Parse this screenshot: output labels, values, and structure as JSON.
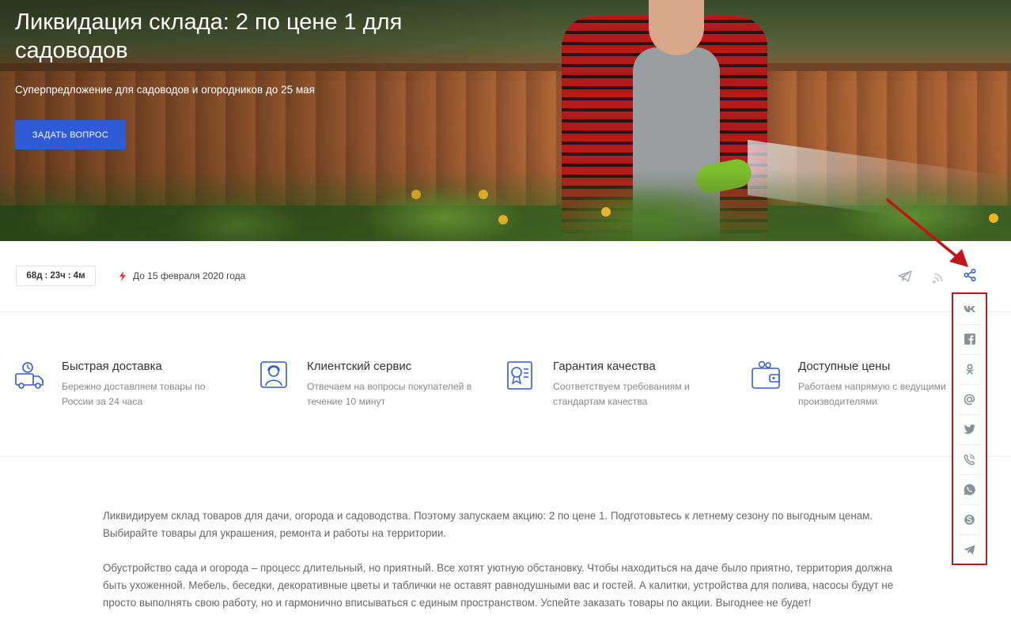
{
  "hero": {
    "title": "Ликвидация склада: 2 по цене 1 для садоводов",
    "subtitle": "Суперпредложение для садоводов и огородников до 25 мая",
    "button_label": "ЗАДАТЬ ВОПРОС"
  },
  "timer": {
    "days": "68",
    "days_unit": "д",
    "hours": "23",
    "hours_unit": "ч",
    "minutes": "4",
    "minutes_unit": "м"
  },
  "deadline": {
    "text": "До 15 февраля 2020 года",
    "icon": "lightning-icon"
  },
  "actions": [
    {
      "name": "telegram-icon"
    },
    {
      "name": "rss-icon"
    },
    {
      "name": "share-icon"
    }
  ],
  "features": [
    {
      "title": "Быстрая доставка",
      "desc": "Бережно доставляем товары по России за 24 часа",
      "icon": "delivery-truck-icon"
    },
    {
      "title": "Клиентский сервис",
      "desc": "Отвечаем на вопросы покупателей в течение 10 минут",
      "icon": "customer-service-icon"
    },
    {
      "title": "Гарантия качества",
      "desc": "Соответствуем требованиям и стандартам качества",
      "icon": "certificate-icon"
    },
    {
      "title": "Доступные цены",
      "desc": "Работаем напрямую с ведущими производителями",
      "icon": "wallet-icon"
    }
  ],
  "share": [
    {
      "name": "vk-icon"
    },
    {
      "name": "facebook-icon"
    },
    {
      "name": "odnoklassniki-icon"
    },
    {
      "name": "mail-at-icon"
    },
    {
      "name": "twitter-icon"
    },
    {
      "name": "viber-icon"
    },
    {
      "name": "whatsapp-icon"
    },
    {
      "name": "skype-icon"
    },
    {
      "name": "telegram-share-icon"
    }
  ],
  "body": {
    "p1": "Ликвидируем склад товаров для дачи, огорода и садоводства. Поэтому запускаем акцию: 2 по цене 1. Подготовьтесь к летнему сезону по выгодным ценам. Выбирайте товары для украшения, ремонта и работы на территории.",
    "p2": "Обустройство сада и огорода – процесс длительный, но приятный. Все хотят уютную обстановку. Чтобы находиться на даче было приятно, территория должна быть ухоженной. Мебель, беседки, декоративные цветы и таблички не оставят равнодушными вас и гостей. А калитки, устройства для полива, насосы будут не просто выполнять свою работу, но и гармонично вписываться с единым пространством. Успейте заказать товары по акции. Выгоднее не будет!"
  },
  "colors": {
    "accent": "#2f5bd6",
    "highlight": "#c21515",
    "icon_gray": "#9aa0a6"
  }
}
